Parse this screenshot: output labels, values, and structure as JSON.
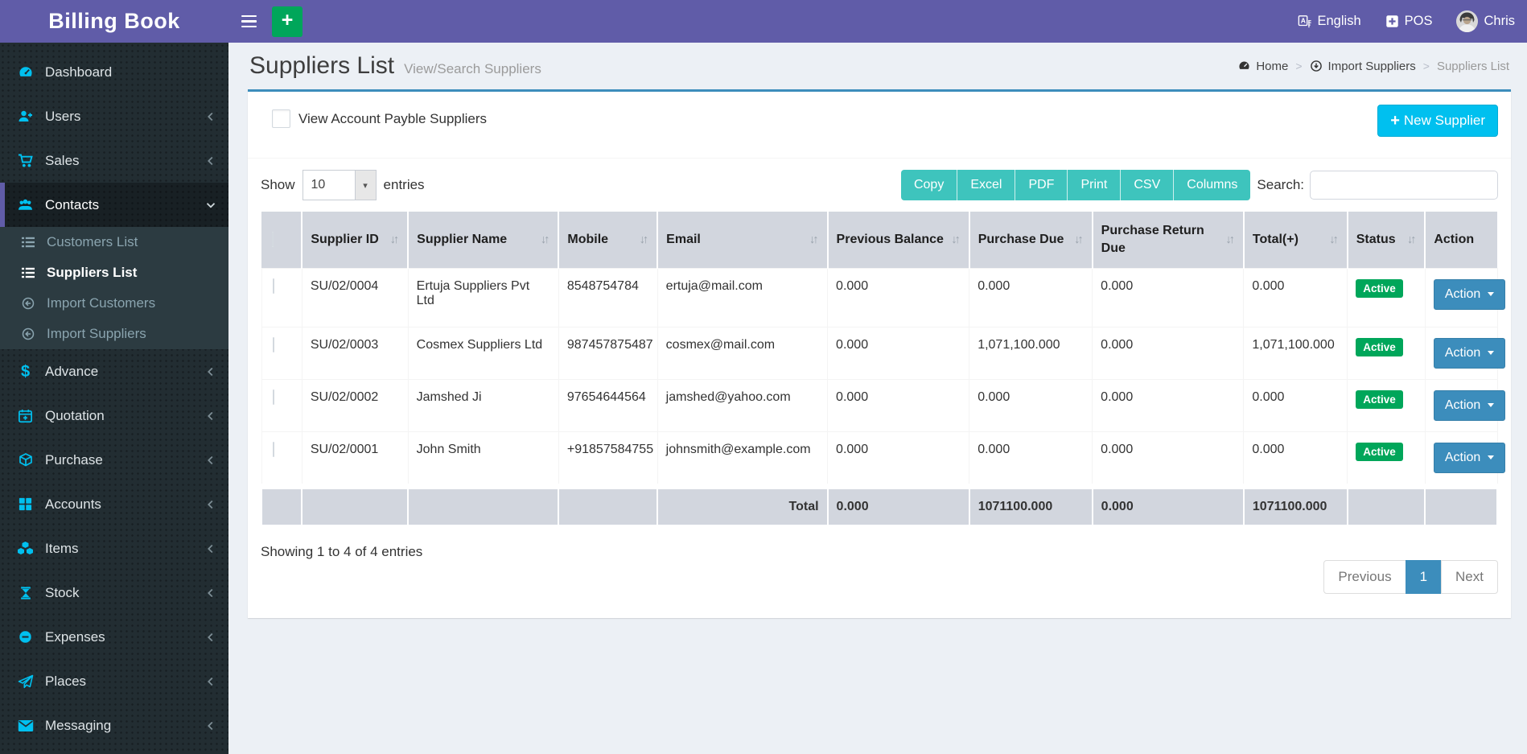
{
  "topbar": {
    "brand": "Billing Book",
    "language": "English",
    "pos": "POS",
    "user": "Chris"
  },
  "sidebar": {
    "items": [
      {
        "label": "Dashboard",
        "icon": "dashboard-icon"
      },
      {
        "label": "Users",
        "icon": "user-plus-icon"
      },
      {
        "label": "Sales",
        "icon": "cart-icon"
      },
      {
        "label": "Contacts",
        "icon": "group-icon",
        "active": true
      },
      {
        "label": "Advance",
        "icon": "dollar-icon"
      },
      {
        "label": "Quotation",
        "icon": "calendar-plus-icon"
      },
      {
        "label": "Purchase",
        "icon": "cube-icon"
      },
      {
        "label": "Accounts",
        "icon": "grid-icon"
      },
      {
        "label": "Items",
        "icon": "cubes-icon"
      },
      {
        "label": "Stock",
        "icon": "hourglass-icon"
      },
      {
        "label": "Expenses",
        "icon": "minus-circle-icon"
      },
      {
        "label": "Places",
        "icon": "paper-plane-icon"
      },
      {
        "label": "Messaging",
        "icon": "envelope-icon"
      }
    ],
    "contacts_submenu": [
      {
        "label": "Customers List",
        "icon": "list-icon"
      },
      {
        "label": "Suppliers List",
        "icon": "list-icon",
        "active": true
      },
      {
        "label": "Import Customers",
        "icon": "import-icon"
      },
      {
        "label": "Import Suppliers",
        "icon": "import-icon"
      }
    ]
  },
  "header": {
    "title": "Suppliers List",
    "subtitle": "View/Search Suppliers",
    "breadcrumb": [
      {
        "label": "Home",
        "icon": "dashboard-icon"
      },
      {
        "label": "Import Suppliers",
        "icon": "import-icon"
      },
      {
        "label": "Suppliers List"
      }
    ]
  },
  "panel": {
    "filter_checkbox_label": "View Account Payble Suppliers",
    "new_supplier_button": "New Supplier",
    "show_label": "Show",
    "page_size": "10",
    "entries_label": "entries",
    "export_buttons": [
      "Copy",
      "Excel",
      "PDF",
      "Print",
      "CSV",
      "Columns"
    ],
    "search_label": "Search:",
    "search_value": ""
  },
  "table": {
    "headers": [
      "Supplier ID",
      "Supplier Name",
      "Mobile",
      "Email",
      "Previous Balance",
      "Purchase Due",
      "Purchase Return Due",
      "Total(+)",
      "Status",
      "Action"
    ],
    "rows": [
      {
        "id": "SU/02/0004",
        "name": "Ertuja Suppliers Pvt Ltd",
        "mobile": "8548754784",
        "email": "ertuja@mail.com",
        "previous_balance": "0.000",
        "purchase_due": "0.000",
        "purchase_return_due": "0.000",
        "total": "0.000",
        "status": "Active",
        "action": "Action"
      },
      {
        "id": "SU/02/0003",
        "name": "Cosmex Suppliers Ltd",
        "mobile": "987457875487",
        "email": "cosmex@mail.com",
        "previous_balance": "0.000",
        "purchase_due": "1,071,100.000",
        "purchase_return_due": "0.000",
        "total": "1,071,100.000",
        "status": "Active",
        "action": "Action"
      },
      {
        "id": "SU/02/0002",
        "name": "Jamshed Ji",
        "mobile": "97654644564",
        "email": "jamshed@yahoo.com",
        "previous_balance": "0.000",
        "purchase_due": "0.000",
        "purchase_return_due": "0.000",
        "total": "0.000",
        "status": "Active",
        "action": "Action"
      },
      {
        "id": "SU/02/0001",
        "name": "John Smith",
        "mobile": "+91857584755",
        "email": "johnsmith@example.com",
        "previous_balance": "0.000",
        "purchase_due": "0.000",
        "purchase_return_due": "0.000",
        "total": "0.000",
        "status": "Active",
        "action": "Action"
      }
    ],
    "footer": {
      "label": "Total",
      "previous_balance": "0.000",
      "purchase_due": "1071100.000",
      "purchase_return_due": "0.000",
      "total": "1071100.000"
    },
    "info": "Showing 1 to 4 of 4 entries",
    "pagination": {
      "previous": "Previous",
      "current": "1",
      "next": "Next"
    }
  },
  "colors": {
    "topbar_purple": "#605CA8",
    "sidebar_bg": "#222D32",
    "sidebar_icon_cyan": "#00C0EF",
    "accent_blue": "#3C8DBC",
    "export_teal": "#3EC4BD",
    "new_supplier_cyan": "#00C0EF",
    "success_green": "#00A65A",
    "table_header_bg": "#D2D6DE",
    "content_bg": "#ECF0F5"
  }
}
